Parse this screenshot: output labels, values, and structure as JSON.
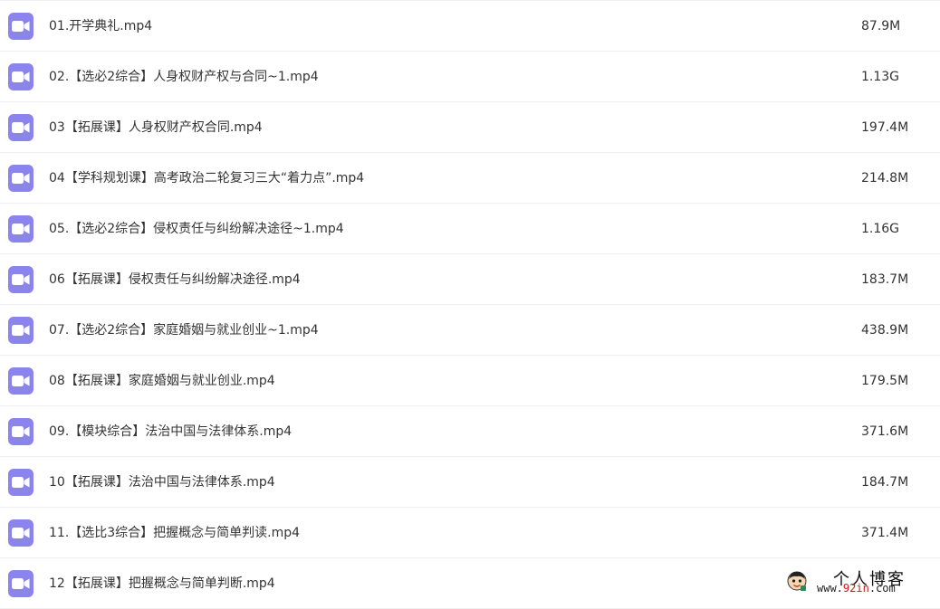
{
  "colors": {
    "video_icon": "#8b84ec",
    "watermark_accent": "#d4141c"
  },
  "files": [
    {
      "name": "01.开学典礼.mp4",
      "size": "87.9M",
      "icon": "video-icon"
    },
    {
      "name": "02.【选必2综合】人身权财产权与合同~1.mp4",
      "size": "1.13G",
      "icon": "video-icon"
    },
    {
      "name": "03【拓展课】人身权财产权合同.mp4",
      "size": "197.4M",
      "icon": "video-icon"
    },
    {
      "name": "04【学科规划课】高考政治二轮复习三大“着力点”.mp4",
      "size": "214.8M",
      "icon": "video-icon"
    },
    {
      "name": "05.【选必2综合】侵权责任与纠纷解决途径~1.mp4",
      "size": "1.16G",
      "icon": "video-icon"
    },
    {
      "name": "06【拓展课】侵权责任与纠纷解决途径.mp4",
      "size": "183.7M",
      "icon": "video-icon"
    },
    {
      "name": "07.【选必2综合】家庭婚姻与就业创业~1.mp4",
      "size": "438.9M",
      "icon": "video-icon"
    },
    {
      "name": "08【拓展课】家庭婚姻与就业创业.mp4",
      "size": "179.5M",
      "icon": "video-icon"
    },
    {
      "name": "09.【模块综合】法治中国与法律体系.mp4",
      "size": "371.6M",
      "icon": "video-icon"
    },
    {
      "name": "10【拓展课】法治中国与法律体系.mp4",
      "size": "184.7M",
      "icon": "video-icon"
    },
    {
      "name": "11.【选比3综合】把握概念与简单判读.mp4",
      "size": "371.4M",
      "icon": "video-icon"
    },
    {
      "name": "12【拓展课】把握概念与简单判断.mp4",
      "size": "",
      "icon": "video-icon"
    }
  ],
  "watermark": {
    "title": "个人博客",
    "url_prefix": "www.",
    "url_accent": "92in",
    "url_suffix": ".com"
  }
}
